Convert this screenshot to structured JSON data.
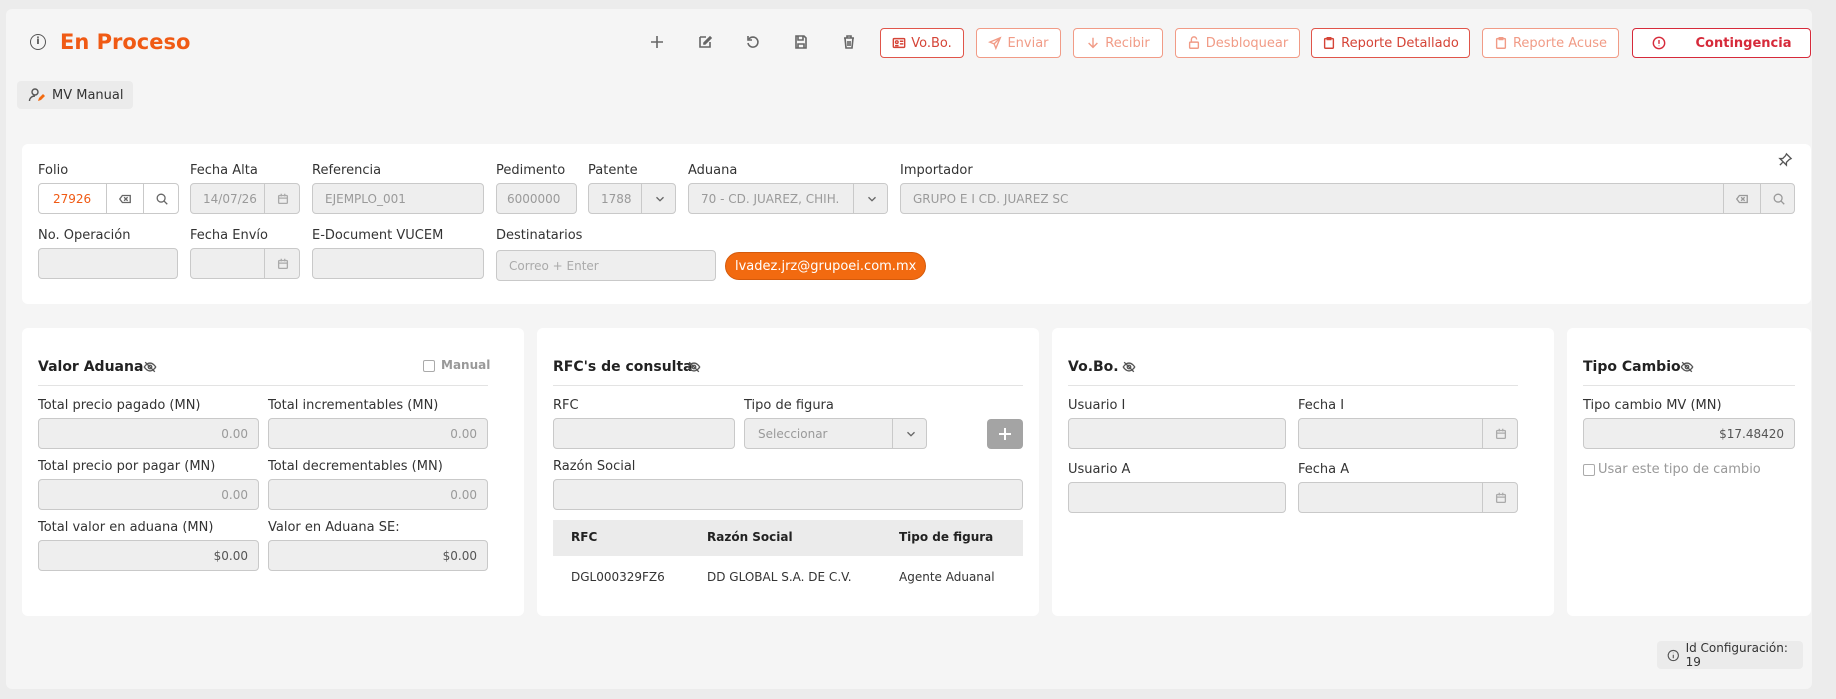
{
  "header": {
    "title": "En Proceso",
    "buttons": {
      "vobo": "Vo.Bo.",
      "enviar": "Enviar",
      "recibir": "Recibir",
      "desbloquear": "Desbloquear",
      "reporte_detallado": "Reporte Detallado",
      "reporte_acuse": "Reporte Acuse",
      "contingencia": "Contingencia"
    }
  },
  "chip": {
    "label": "MV Manual"
  },
  "general": {
    "folio": {
      "label": "Folio",
      "value": "27926"
    },
    "fecha_alta": {
      "label": "Fecha Alta",
      "value": "14/07/26"
    },
    "referencia": {
      "label": "Referencia",
      "value": "EJEMPLO_001"
    },
    "pedimento": {
      "label": "Pedimento",
      "value": "6000000"
    },
    "patente": {
      "label": "Patente",
      "value": "1788"
    },
    "aduana": {
      "label": "Aduana",
      "value": "70 - CD. JUAREZ, CHIH."
    },
    "importador": {
      "label": "Importador",
      "value": "GRUPO E I CD. JUAREZ SC"
    },
    "no_operacion": {
      "label": "No. Operación",
      "value": ""
    },
    "fecha_envio": {
      "label": "Fecha Envío",
      "value": ""
    },
    "edocument": {
      "label": "E-Document VUCEM",
      "value": ""
    },
    "destinatarios": {
      "label": "Destinatarios",
      "placeholder": "Correo + Enter",
      "tags": [
        "lvadez.jrz@grupoei.com.mx"
      ]
    }
  },
  "valor_aduana": {
    "title": "Valor Aduana",
    "manual_label": "Manual",
    "fields": {
      "total_pagado": {
        "label": "Total precio pagado (MN)",
        "value": "0.00"
      },
      "total_incrementables": {
        "label": "Total incrementables (MN)",
        "value": "0.00"
      },
      "total_por_pagar": {
        "label": "Total precio por pagar (MN)",
        "value": "0.00"
      },
      "total_decrementables": {
        "label": "Total decrementables (MN)",
        "value": "0.00"
      },
      "total_valor_aduana": {
        "label": "Total valor en aduana (MN)",
        "value": "$0.00"
      },
      "valor_aduana_se": {
        "label": "Valor en Aduana SE:",
        "value": "$0.00"
      }
    }
  },
  "rfcs": {
    "title": "RFC's de consulta",
    "rfc_label": "RFC",
    "tipo_label": "Tipo de figura",
    "tipo_placeholder": "Seleccionar",
    "razon_label": "Razón Social",
    "table": {
      "columns": [
        "RFC",
        "Razón Social",
        "Tipo de figura"
      ],
      "rows": [
        [
          "DGL000329FZ6",
          "DD GLOBAL S.A. DE C.V.",
          "Agente Aduanal"
        ]
      ]
    }
  },
  "vobo": {
    "title": "Vo.Bo.",
    "usuario_i": "Usuario I",
    "fecha_i": "Fecha I",
    "usuario_a": "Usuario A",
    "fecha_a": "Fecha A"
  },
  "tipo_cambio": {
    "title": "Tipo Cambio",
    "label": "Tipo cambio MV (MN)",
    "value": "$17.48420",
    "checkbox_label": "Usar este tipo de cambio"
  },
  "footer": {
    "config_label": "Id Configuración: 19"
  },
  "colors": {
    "accent": "#f05a14",
    "danger": "#d62a3a",
    "tag": "#f26a10"
  }
}
